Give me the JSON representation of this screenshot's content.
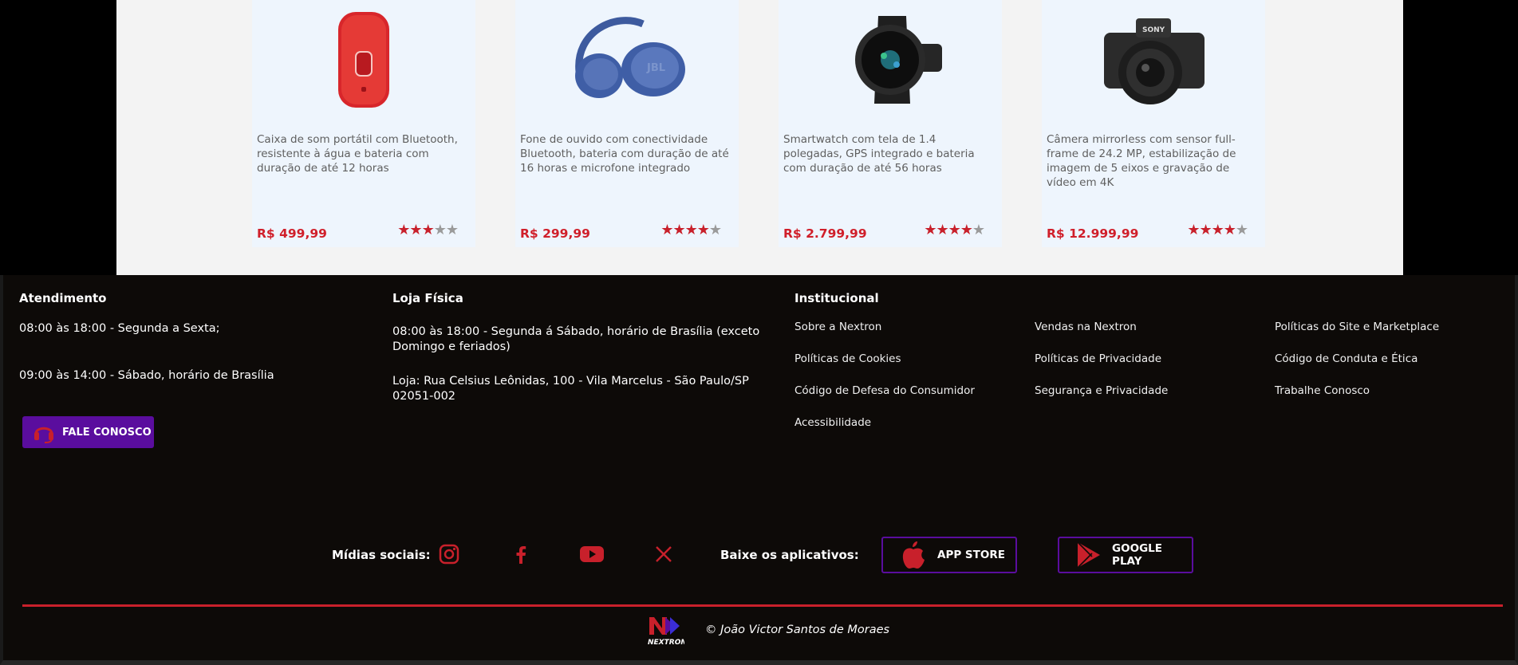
{
  "products": [
    {
      "image_icon": "bluetooth-speaker",
      "description": "Caixa de som portátil com Bluetooth, resistente à água e bateria com duração de até 12 horas",
      "price": "R$ 499,99",
      "rating": 3,
      "max_rating": 5
    },
    {
      "image_icon": "headphones",
      "description": "Fone de ouvido com conectividade Bluetooth, bateria com duração de até 16 horas e microfone integrado",
      "price": "R$ 299,99",
      "rating": 4,
      "max_rating": 5
    },
    {
      "image_icon": "smartwatch",
      "description": "Smartwatch com tela de 1.4 polegadas, GPS integrado e bateria com duração de até 56 horas",
      "price": "R$ 2.799,99",
      "rating": 4,
      "max_rating": 5
    },
    {
      "image_icon": "mirrorless-camera",
      "description": "Câmera mirrorless com sensor full-frame de 24.2 MP, estabilização de imagem de 5 eixos e gravação de vídeo em 4K",
      "price": "R$ 12.999,99",
      "rating": 4,
      "max_rating": 5
    }
  ],
  "footer": {
    "atendimento": {
      "title": "Atendimento",
      "line1": "08:00 às 18:00 - Segunda a Sexta;",
      "line2": "09:00 às 14:00 - Sábado, horário de Brasília",
      "button_label": "FALE CONOSCO"
    },
    "loja": {
      "title": "Loja Física",
      "hours": "08:00 às 18:00 - Segunda á Sábado, horário de Brasília (exceto Domingo e feriados)",
      "address": "Loja: Rua Celsius Leônidas, 100 - Vila Marcelus - São Paulo/SP 02051-002"
    },
    "institucional": {
      "title": "Institucional",
      "links": [
        "Sobre a Nextron",
        "Vendas na Nextron",
        "Políticas do Site e Marketplace",
        "Políticas de Cookies",
        "Políticas de Privacidade",
        "Código de Conduta e Ética",
        "Código de Defesa do Consumidor",
        "Segurança e Privacidade",
        "Trabalhe Conosco",
        "Acessibilidade"
      ]
    },
    "social": {
      "label": "Mídias sociais:",
      "icons": [
        "instagram-icon",
        "facebook-icon",
        "youtube-icon",
        "x-icon"
      ]
    },
    "apps": {
      "label": "Baixe os aplicativos:",
      "app_store": "APP STORE",
      "google_play": "GOOGLE PLAY"
    },
    "logo_text": "NEXTRON",
    "copyright": "© João Victor Santos de Moraes",
    "colors": {
      "accent_red": "#c8202b",
      "accent_purple": "#5a0d9e",
      "background": "#0d0a08"
    }
  }
}
